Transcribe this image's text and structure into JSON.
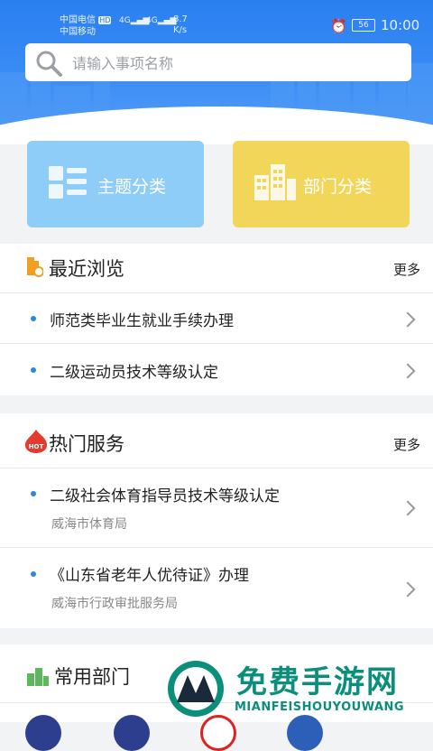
{
  "status_bar": {
    "carrier_1": "中国电信",
    "carrier_1_badge": "HD",
    "carrier_2": "中国移动",
    "signal_1": "4G",
    "signal_2": "4G",
    "net_speed_value": "8.7",
    "net_speed_unit": "K/s",
    "battery": "56",
    "time": "10:00"
  },
  "search": {
    "placeholder": "请输入事项名称"
  },
  "categories": [
    {
      "label": "主题分类",
      "color": "#8dcdf8",
      "icon": "grid-list-icon"
    },
    {
      "label": "部门分类",
      "color": "#f1d65a",
      "icon": "building-icon"
    }
  ],
  "recent": {
    "title": "最近浏览",
    "more": "更多",
    "items": [
      {
        "title": "师范类毕业生就业手续办理"
      },
      {
        "title": "二级运动员技术等级认定"
      }
    ]
  },
  "hot": {
    "title": "热门服务",
    "badge": "HOT",
    "more": "更多",
    "items": [
      {
        "title": "二级社会体育指导员技术等级认定",
        "dept": "威海市体育局"
      },
      {
        "title": "《山东省老年人优待证》办理",
        "dept": "威海市行政审批服务局"
      }
    ]
  },
  "common": {
    "title": "常用部门"
  },
  "watermark": {
    "title": "免费手游网",
    "subtitle": "MIANFEISHOUYOUWANG"
  },
  "colors": {
    "accent": "#2e86de",
    "header": "#2a7ff0",
    "watermark": "#0b8f7a"
  }
}
